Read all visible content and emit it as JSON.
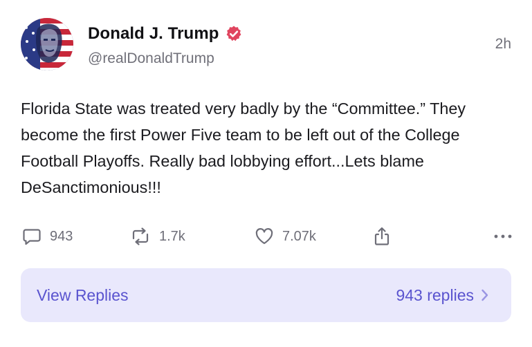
{
  "author": {
    "display_name": "Donald J. Trump",
    "handle": "@realDonaldTrump",
    "verified": true
  },
  "timestamp": "2h",
  "post": {
    "text": "Florida State was treated very badly by the “Committee.” They become the first Power Five team to be left out of the College Football Playoffs. Really bad lobbying effort...Lets blame DeSanctimonious!!!"
  },
  "actions": {
    "reply_count": "943",
    "retruth_count": "1.7k",
    "like_count": "7.07k",
    "share_icon": "share-icon",
    "more_icon": "more-icon"
  },
  "replies_bar": {
    "view_label": "View Replies",
    "count_label": "943 replies"
  },
  "colors": {
    "accent": "#5a54cf",
    "accent_bg": "#e9e8fc",
    "verified": "#e0455f",
    "muted": "#707079",
    "text": "#1b1b1f"
  }
}
